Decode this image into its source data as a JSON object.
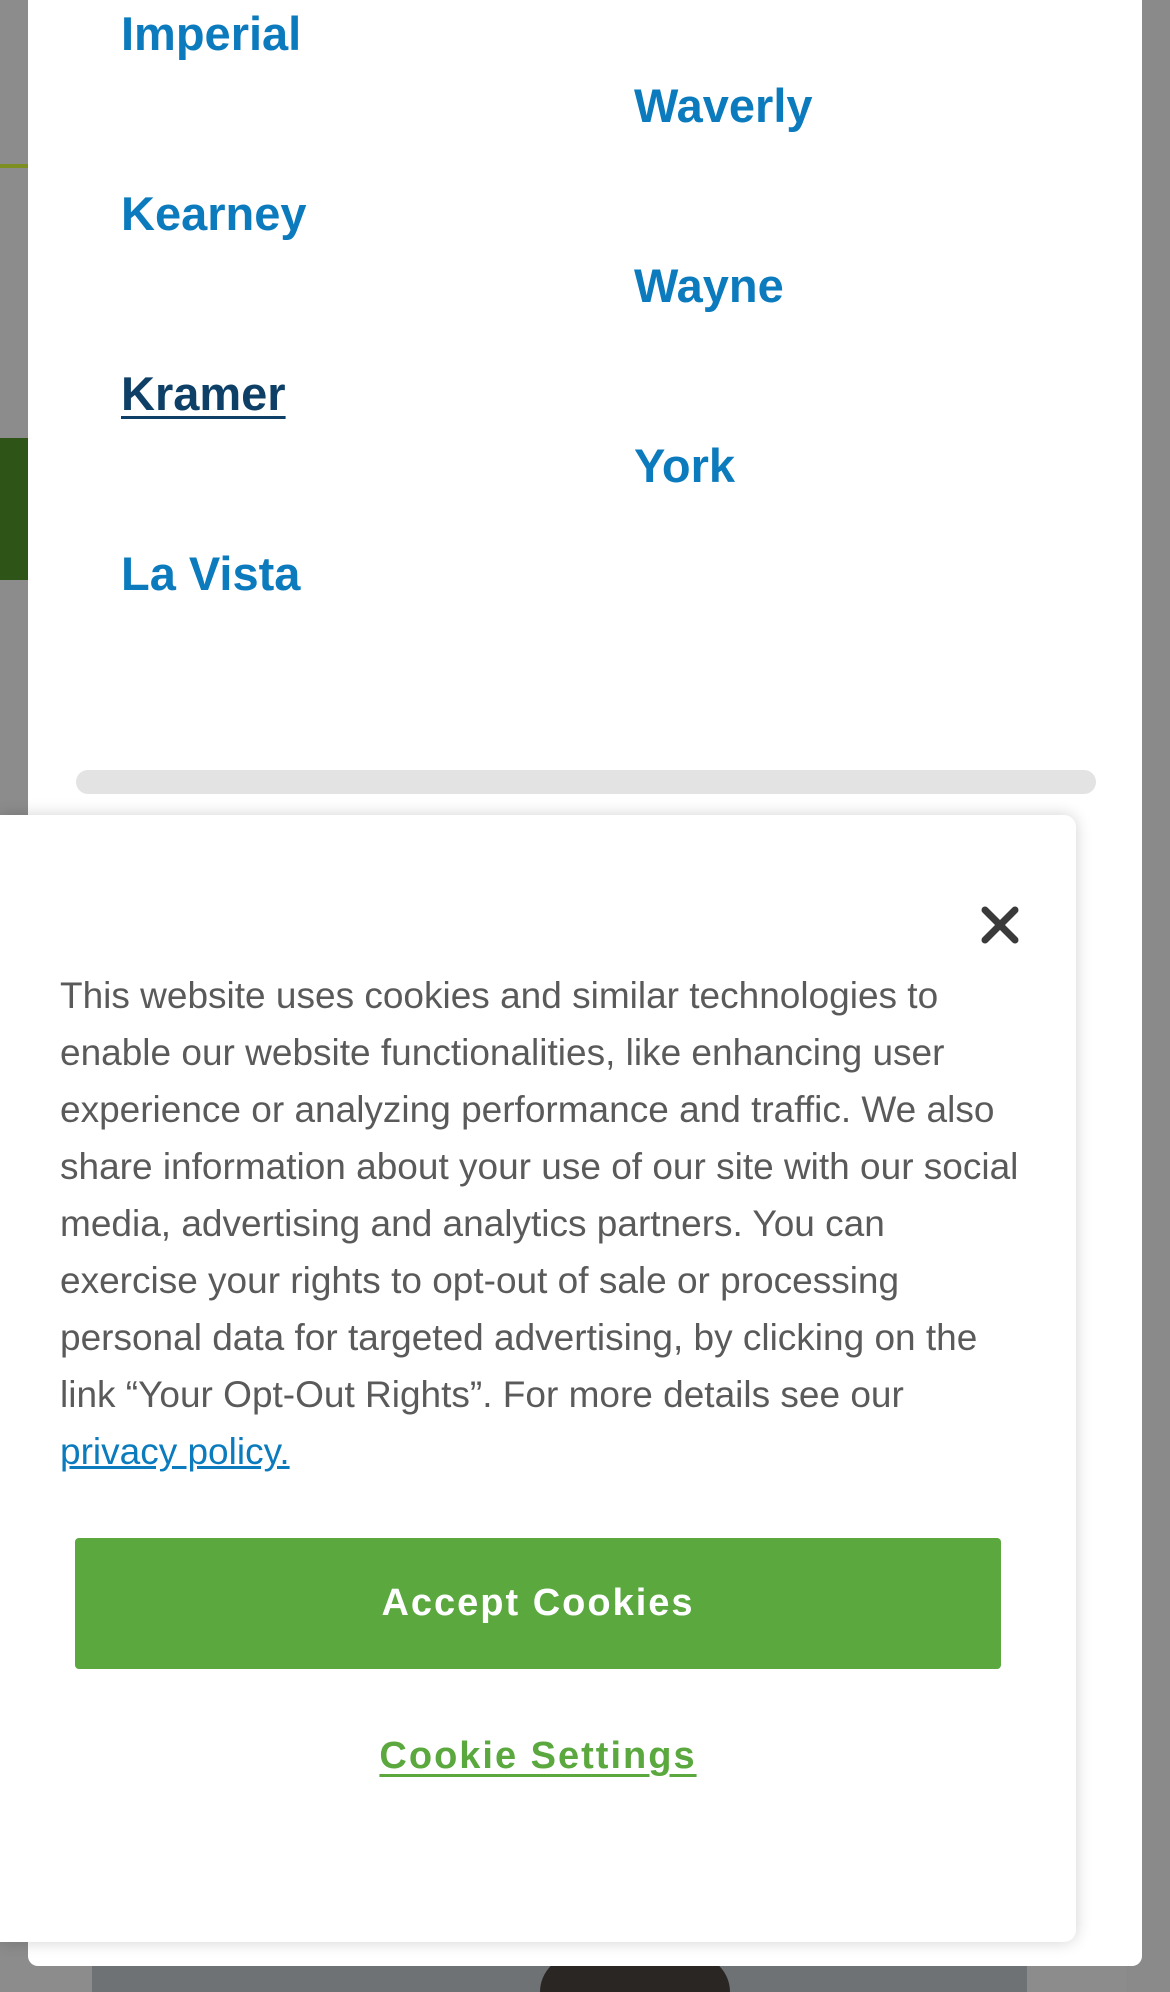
{
  "locations": {
    "left": [
      "Imperial",
      "Kearney",
      "Kramer",
      "La Vista"
    ],
    "right": [
      "Waverly",
      "Wayne",
      "York"
    ],
    "active": "Kramer"
  },
  "cookie_banner": {
    "text": "This website uses cookies and similar technologies to enable our website functionalities, like enhancing user experience or analyzing performance and traffic. We also share information about your use of our site with our social media, advertising and analytics partners. You can exercise your rights to opt-out of sale or processing personal data for targeted advertising, by clicking on the link “Your Opt-Out Rights”. For more details see our ",
    "privacy_link": "privacy policy.",
    "accept_label": "Accept Cookies",
    "settings_label": "Cookie Settings",
    "close_icon": "close-icon"
  },
  "colors": {
    "link_blue": "#0b7bbd",
    "active_link": "#0e3f66",
    "accent_green": "#5aa83e"
  }
}
